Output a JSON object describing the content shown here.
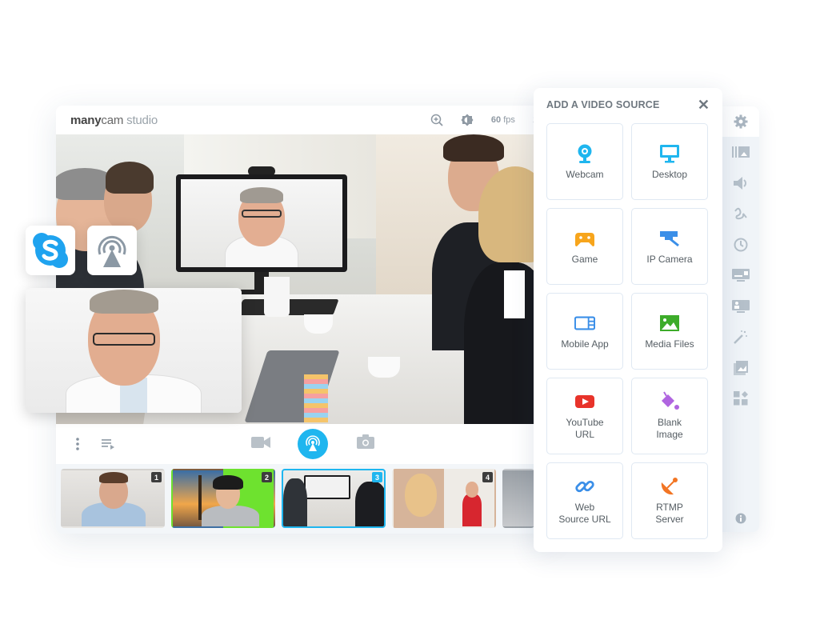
{
  "app": {
    "logo_bold": "many",
    "logo_light": "cam",
    "logo_suffix": "studio",
    "fps_value": "60",
    "fps_unit": "fps",
    "truncated_indicator": "1"
  },
  "overlays": [
    {
      "name": "skype",
      "icon": "skype-icon",
      "color": "#1fa3ef"
    },
    {
      "name": "broadcast",
      "icon": "broadcast-tower-icon",
      "color": "#8b98a4"
    }
  ],
  "controls": {
    "menu_icon": "more-vertical-icon",
    "playlist_icon": "playlist-icon",
    "video_icon": "video-camera-icon",
    "broadcast_icon": "broadcast-icon",
    "snapshot_icon": "camera-snapshot-icon",
    "mic_icon": "microphone-icon",
    "accent": "#1fb6ef"
  },
  "presets": [
    {
      "number": "1",
      "active": false,
      "description": "man in blue shirt"
    },
    {
      "number": "2",
      "active": false,
      "description": "green screen Eiffel tower"
    },
    {
      "number": "3",
      "active": true,
      "description": "conference meeting"
    },
    {
      "number": "4",
      "active": false,
      "description": "smiling woman"
    }
  ],
  "panel": {
    "title": "ADD A VIDEO SOURCE",
    "close_label": "✕",
    "sources": [
      {
        "label": "Webcam",
        "icon": "webcam-icon",
        "color": "#1fb6ef"
      },
      {
        "label": "Desktop",
        "icon": "desktop-icon",
        "color": "#1fb6ef"
      },
      {
        "label": "Game",
        "icon": "gamepad-icon",
        "color": "#f7a51c"
      },
      {
        "label": "IP Camera",
        "icon": "ip-camera-icon",
        "color": "#3b8fe8"
      },
      {
        "label": "Mobile App",
        "icon": "mobile-app-icon",
        "color": "#3b8fe8"
      },
      {
        "label": "Media Files",
        "icon": "image-icon",
        "color": "#3dac2a"
      },
      {
        "label": "YouTube\nURL",
        "icon": "youtube-icon",
        "color": "#e8332a"
      },
      {
        "label": "Blank\nImage",
        "icon": "paint-bucket-icon",
        "color": "#b065e0"
      },
      {
        "label": "Web\nSource URL",
        "icon": "link-icon",
        "color": "#3b8fe8"
      },
      {
        "label": "RTMP\nServer",
        "icon": "satellite-dish-icon",
        "color": "#f27524"
      }
    ]
  },
  "side_rail": {
    "items": [
      "settings-icon",
      "layers-icon",
      "audio-icon",
      "drawing-icon",
      "clock-icon",
      "lower-thirds-icon",
      "presenter-icon",
      "effects-wand-icon",
      "image-overlay-icon",
      "widgets-icon"
    ],
    "bottom": "info-icon",
    "icon_color": "#a9b5c0"
  }
}
